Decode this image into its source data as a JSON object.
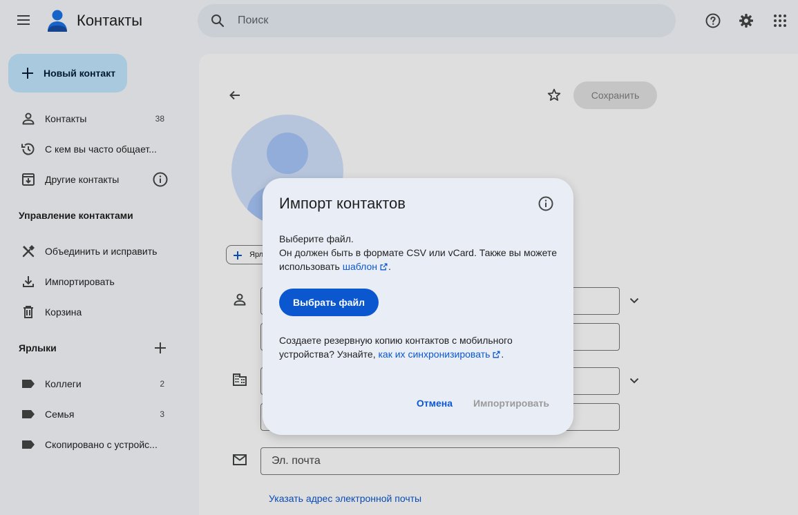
{
  "header": {
    "app_title": "Контакты",
    "search_placeholder": "Поиск",
    "icons": [
      "menu-icon",
      "contacts-logo",
      "search-icon",
      "help-icon",
      "settings-icon",
      "apps-icon"
    ]
  },
  "sidebar": {
    "new_contact_label": "Новый контакт",
    "items": [
      {
        "label": "Контакты",
        "count": "38",
        "icon": "person-icon"
      },
      {
        "label": "С кем вы часто общает...",
        "icon": "history-icon"
      },
      {
        "label": "Другие контакты",
        "icon": "archive-icon"
      }
    ],
    "manage_title": "Управление контактами",
    "manage_items": [
      {
        "label": "Объединить и исправить",
        "icon": "merge-tools-icon"
      },
      {
        "label": "Импортировать",
        "icon": "download-icon"
      },
      {
        "label": "Корзина",
        "icon": "trash-icon"
      }
    ],
    "labels_title": "Ярлыки",
    "labels": [
      {
        "label": "Коллеги",
        "count": "2"
      },
      {
        "label": "Семья",
        "count": "3"
      },
      {
        "label": "Скопировано с устройс..."
      }
    ]
  },
  "main": {
    "save_label": "Сохранить",
    "chip_label": "Ярлы",
    "email_placeholder": "Эл. почта",
    "add_email_link": "Указать адрес электронной почты"
  },
  "dialog": {
    "title": "Импорт контактов",
    "line1": "Выберите файл.",
    "line2": "Он должен быть в формате CSV или vCard. Также вы можете использовать ",
    "template_link": "шаблон",
    "line2_end": ".",
    "choose_file_label": "Выбрать файл",
    "backup_text": "Создаете резервную копию контактов с мобильного устройства? Узнайте, ",
    "sync_link": "как их синхронизировать",
    "backup_end": ".",
    "cancel_label": "Отмена",
    "import_label": "Импортировать"
  },
  "colors": {
    "accent": "#0b57d0",
    "fab_bg": "#c2e7ff",
    "dialog_bg": "#e9eef6",
    "page_bg": "#f6f8fc"
  }
}
